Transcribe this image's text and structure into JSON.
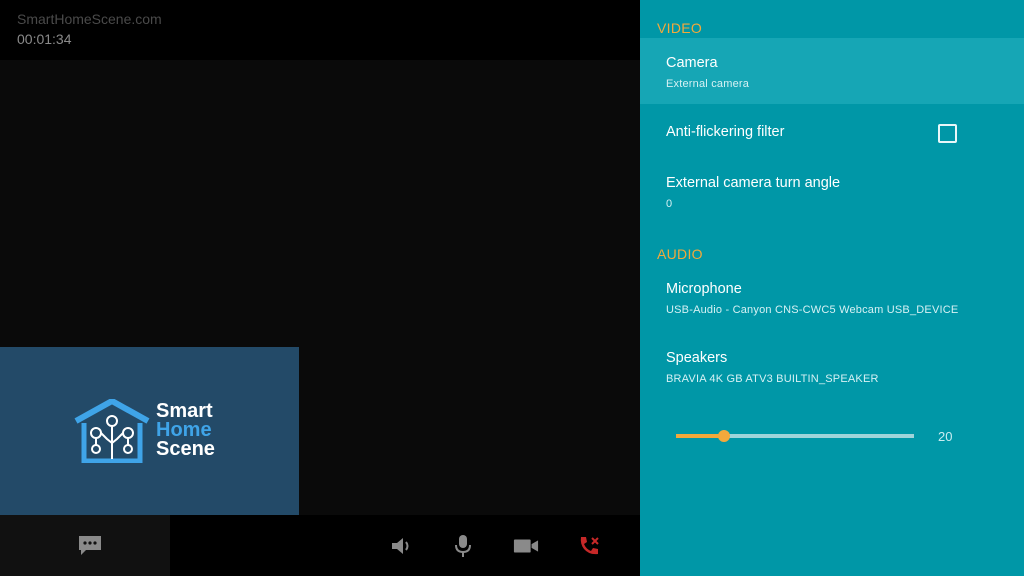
{
  "call": {
    "caller": "SmartHomeScene.com",
    "duration": "00:01:34"
  },
  "logo": {
    "line1": "Smart",
    "line2": "Home",
    "line3": "Scene"
  },
  "toolbar": {
    "icons": [
      "chat-icon",
      "speaker-icon",
      "microphone-icon",
      "video-camera-icon",
      "end-call-icon"
    ]
  },
  "settings": {
    "video": {
      "header": "VIDEO",
      "camera_label": "Camera",
      "camera_value": "External camera",
      "anti_flicker_label": "Anti-flickering filter",
      "anti_flicker_checked": false,
      "turn_angle_label": "External camera turn angle",
      "turn_angle_value": "0"
    },
    "audio": {
      "header": "AUDIO",
      "microphone_label": "Microphone",
      "microphone_value": "USB-Audio - Canyon CNS-CWC5 Webcam USB_DEVICE",
      "speakers_label": "Speakers",
      "speakers_value": "BRAVIA 4K GB ATV3 BUILTIN_SPEAKER",
      "volume_value": "20",
      "volume_fraction": 0.2
    }
  },
  "colors": {
    "panel": "#0097a7",
    "accent": "#f2a93b",
    "focused_row": "#16a6b5",
    "self_view": "#234a68"
  }
}
